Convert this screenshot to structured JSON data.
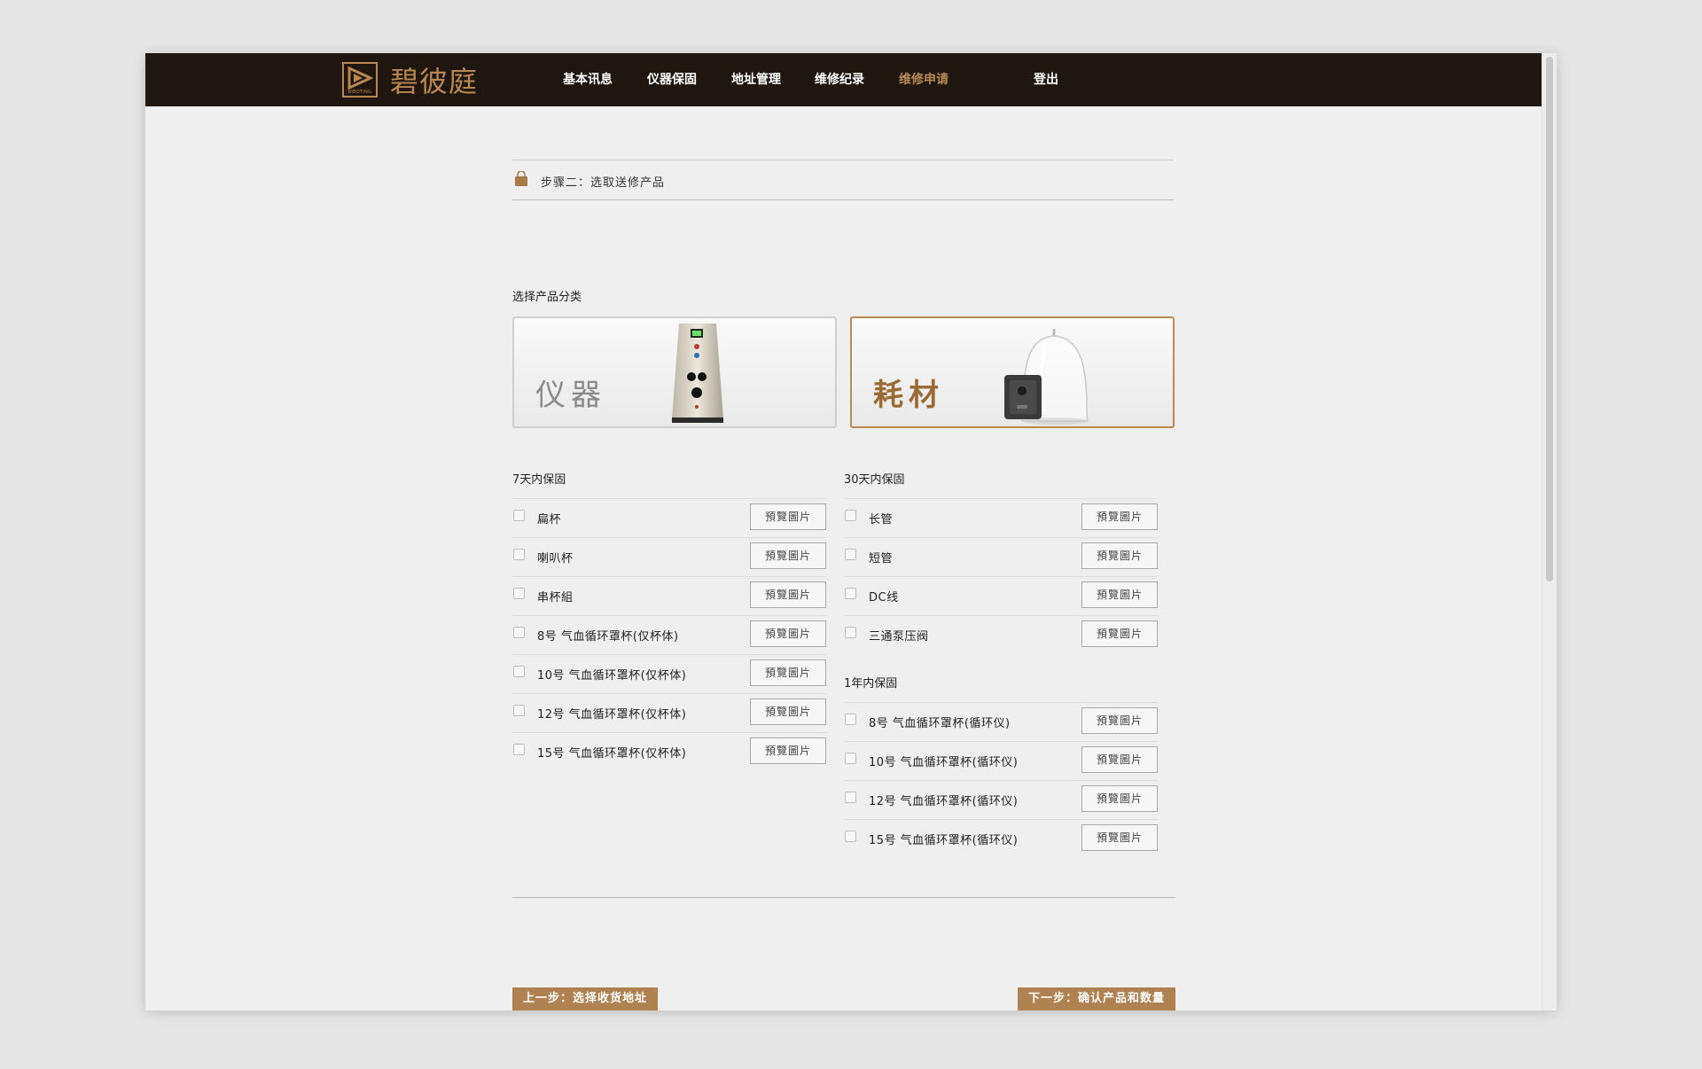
{
  "header": {
    "logo_text": "碧彼庭",
    "logo_sub": "BIBOTING",
    "nav": [
      {
        "label": "基本讯息"
      },
      {
        "label": "仪器保固"
      },
      {
        "label": "地址管理"
      },
      {
        "label": "维修纪录"
      },
      {
        "label": "维修申请",
        "active": true
      },
      {
        "label": "登出"
      }
    ]
  },
  "step": {
    "text": "步骤二：选取送修产品"
  },
  "category": {
    "label": "选择产品分类",
    "cards": [
      {
        "label": "仪器",
        "selected": false
      },
      {
        "label": "耗材",
        "selected": true
      }
    ]
  },
  "warranty_groups": [
    {
      "title": "7天内保固",
      "items": [
        {
          "name": "扁杯",
          "button": "預覽圖片",
          "checked": false
        },
        {
          "name": "喇叭杯",
          "button": "預覽圖片",
          "checked": false
        },
        {
          "name": "串杯組",
          "button": "預覽圖片",
          "checked": false
        },
        {
          "name": "8号 气血循环罩杯(仅杯体)",
          "button": "預覽圖片",
          "checked": false
        },
        {
          "name": "10号 气血循环罩杯(仅杯体)",
          "button": "預覽圖片",
          "checked": false
        },
        {
          "name": "12号 气血循环罩杯(仅杯体)",
          "button": "預覽圖片",
          "checked": false
        },
        {
          "name": "15号 气血循环罩杯(仅杯体)",
          "button": "預覽圖片",
          "checked": false
        }
      ]
    },
    {
      "title": "30天内保固",
      "items": [
        {
          "name": "长管",
          "button": "預覽圖片",
          "checked": false
        },
        {
          "name": "短管",
          "button": "預覽圖片",
          "checked": false
        },
        {
          "name": "DC线",
          "button": "預覽圖片",
          "checked": false
        },
        {
          "name": "三通泵压阀",
          "button": "預覽圖片",
          "checked": false
        }
      ]
    },
    {
      "title": "1年内保固",
      "items": [
        {
          "name": "8号 气血循环罩杯(循环仪)",
          "button": "預覽圖片",
          "checked": false
        },
        {
          "name": "10号 气血循环罩杯(循环仪)",
          "button": "預覽圖片",
          "checked": false
        },
        {
          "name": "12号 气血循环罩杯(循环仪)",
          "button": "預覽圖片",
          "checked": false
        },
        {
          "name": "15号 气血循环罩杯(循环仪)",
          "button": "預覽圖片",
          "checked": false
        }
      ]
    }
  ],
  "actions": {
    "prev": "上一步：选择收货地址",
    "next": "下一步：确认产品和数量"
  },
  "colors": {
    "header_bg": "#1f1610",
    "accent": "#b08252",
    "active_nav": "#b98a55"
  },
  "icons": {
    "step_icon": "bag-icon",
    "logo_icon": "play-logo-icon"
  }
}
